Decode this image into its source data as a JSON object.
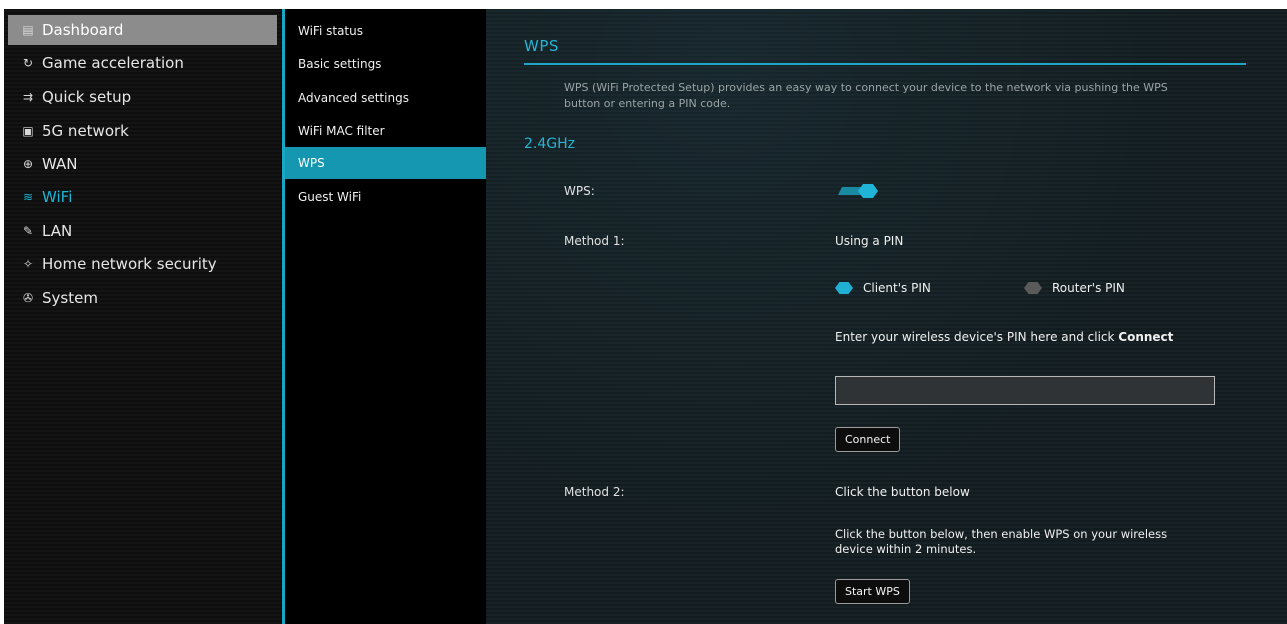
{
  "sidebar": {
    "items": [
      {
        "icon": "dashboard-icon",
        "glyph": "▤",
        "label": "Dashboard"
      },
      {
        "icon": "game-acceleration-icon",
        "glyph": "↻",
        "label": "Game acceleration"
      },
      {
        "icon": "quick-setup-icon",
        "glyph": "⇉",
        "label": "Quick setup"
      },
      {
        "icon": "5g-network-icon",
        "glyph": "▣",
        "label": "5G network"
      },
      {
        "icon": "wan-globe-icon",
        "glyph": "⊕",
        "label": "WAN"
      },
      {
        "icon": "wifi-icon",
        "glyph": "≋",
        "label": "WiFi"
      },
      {
        "icon": "lan-icon",
        "glyph": "✎",
        "label": "LAN"
      },
      {
        "icon": "home-network-security-icon",
        "glyph": "✧",
        "label": "Home network security"
      },
      {
        "icon": "system-icon",
        "glyph": "✇",
        "label": "System"
      }
    ]
  },
  "subnav": {
    "items": [
      {
        "label": "WiFi status"
      },
      {
        "label": "Basic settings"
      },
      {
        "label": "Advanced settings"
      },
      {
        "label": "WiFi MAC filter"
      },
      {
        "label": "WPS"
      },
      {
        "label": "Guest WiFi"
      }
    ]
  },
  "main": {
    "title": "WPS",
    "description": "WPS (WiFi Protected Setup) provides an easy way to connect your device to the network via pushing the WPS button or entering a PIN code.",
    "band_title": "2.4GHz",
    "wps_label": "WPS:",
    "wps_enabled": true,
    "method1_label": "Method 1:",
    "method1_value": "Using a PIN",
    "radio_client": "Client's PIN",
    "radio_router": "Router's PIN",
    "pin_selected": "Client's PIN",
    "pin_instruction_prefix": "Enter your wireless device's PIN here and click ",
    "pin_instruction_bold": "Connect",
    "pin_value": "",
    "connect_label": "Connect",
    "method2_label": "Method 2:",
    "method2_value": "Click the button below",
    "method2_description": "Click the button below, then enable WPS on your wireless device within 2 minutes.",
    "start_wps_label": "Start WPS"
  },
  "colors": {
    "accent": "#1bb5d6",
    "active_sidebar": "#8c8c8c",
    "active_subnav": "#1596b1"
  }
}
